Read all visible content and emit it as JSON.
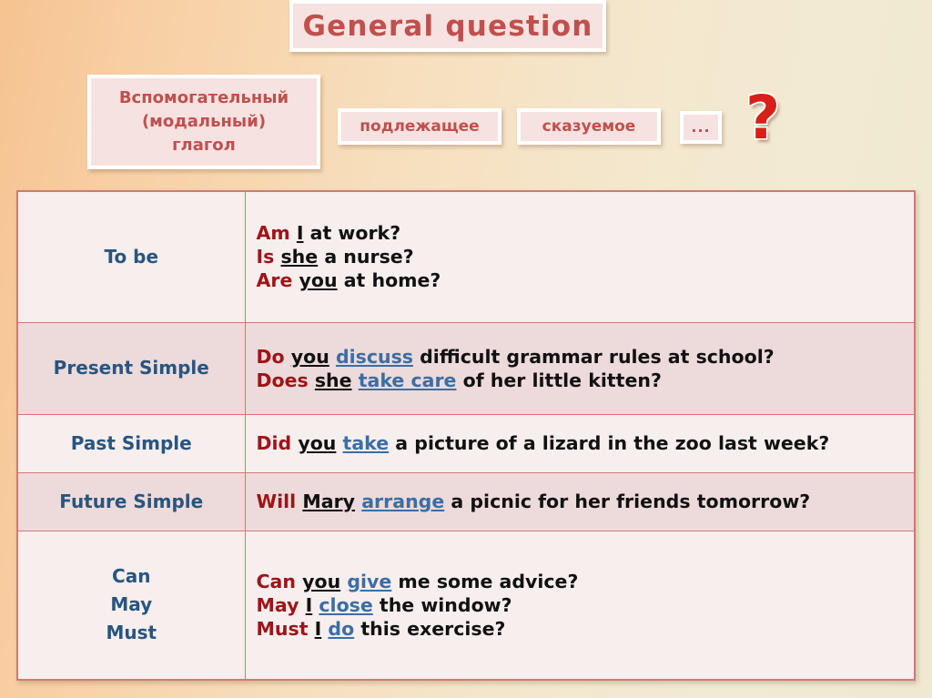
{
  "title": {
    "text": "General question"
  },
  "header": {
    "aux_box": "Вспомогательный\n(модальный)\nглагол",
    "aux_box_line1": "Вспомогательный",
    "aux_box_line2": "(модальный)",
    "aux_box_line3": "глагол",
    "subject_box": "подлежащее",
    "predicate_box": "сказуемое",
    "ellipsis_box": "...",
    "question_mark": "?"
  },
  "colors": {
    "title_text": "#c0504d",
    "chip_bg": "#f6e2e0",
    "chip_border": "#ffffff",
    "tense_text": "#28557f",
    "aux_verb": "#9e1418",
    "predicate": "#3b6ea5",
    "table_border": "#cf7a73",
    "row_light": "#f7eeee",
    "row_shaded": "#eddada",
    "question_mark": "#d81f18",
    "bg_left": "#f6c391",
    "bg_right": "#efe9cf"
  },
  "table": {
    "rows": [
      {
        "tense": "To be",
        "shaded": false,
        "sentences": [
          {
            "aux": "Am",
            "subj": "I",
            "pred": "",
            "rest": " at work?"
          },
          {
            "aux": "Is",
            "subj": "she",
            "pred": "",
            "rest": " a nurse?"
          },
          {
            "aux": "Are",
            "subj": "you",
            "pred": "",
            "rest": " at home?"
          }
        ]
      },
      {
        "tense": "Present Simple",
        "shaded": true,
        "sentences": [
          {
            "aux": "Do",
            "subj": "you",
            "pred": "discuss",
            "rest": " difficult grammar rules at school?"
          },
          {
            "aux": "Does",
            "subj": "she",
            "pred": "take care",
            "rest": " of her little kitten?"
          }
        ]
      },
      {
        "tense": "Past Simple",
        "shaded": false,
        "sentences": [
          {
            "aux": "Did",
            "subj": "you",
            "pred": "take",
            "rest": " a picture of a lizard in the zoo last week?"
          }
        ]
      },
      {
        "tense": "Future Simple",
        "shaded": true,
        "sentences": [
          {
            "aux": "Will",
            "subj": "Mary",
            "pred": "arrange",
            "rest": " a picnic for her friends tomorrow?"
          }
        ]
      },
      {
        "tense": "Can\nMay\nMust",
        "tense_line1": "Can",
        "tense_line2": "May",
        "tense_line3": "Must",
        "shaded": false,
        "sentences": [
          {
            "aux": "Can",
            "subj": "you",
            "pred": "give",
            "rest": " me some advice?"
          },
          {
            "aux": "May",
            "subj": "I",
            "pred": "close",
            "rest": " the window?"
          },
          {
            "aux": "Must",
            "subj": "I",
            "pred": "do",
            "rest": " this exercise?"
          }
        ]
      }
    ]
  }
}
